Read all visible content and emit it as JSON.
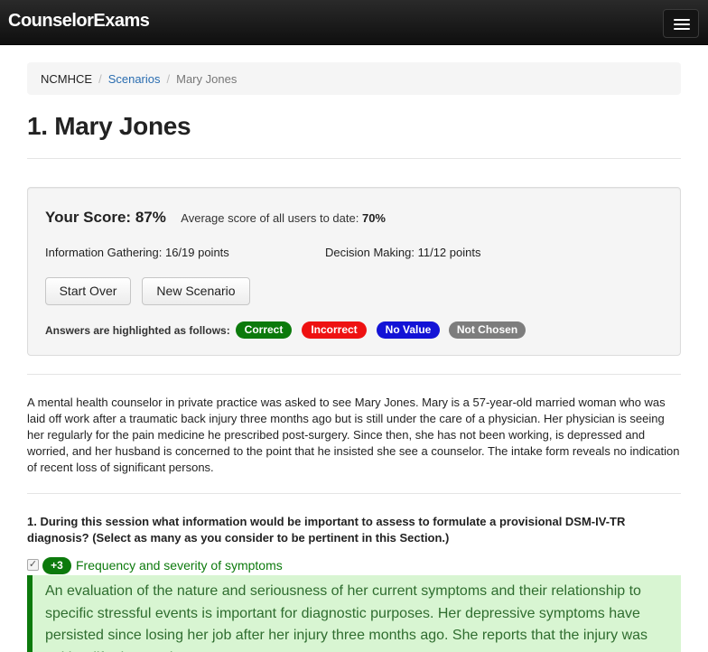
{
  "navbar": {
    "brand": "CounselorExams"
  },
  "breadcrumb": {
    "home": "NCMHCE",
    "separator": "/",
    "scenarios_link": "Scenarios",
    "current": "Mary Jones"
  },
  "page_title": "1. Mary Jones",
  "score": {
    "your_score_label": "Your Score: 87%",
    "average_prefix": "Average score of all users to date:",
    "average_value": "70%",
    "information_gathering": "Information Gathering: 16/19 points",
    "decision_making": "Decision Making: 11/12 points",
    "start_over_label": "Start Over",
    "new_scenario_label": "New Scenario",
    "legend_label": "Answers are highlighted as follows:",
    "legend": {
      "correct": "Correct",
      "incorrect": "Incorrect",
      "no_value": "No Value",
      "not_chosen": "Not Chosen"
    }
  },
  "colors": {
    "correct": "#0c7a0c",
    "incorrect": "#ee1111",
    "no_value": "#1313d6",
    "not_chosen": "#7d7d7d",
    "link": "#2a6db0",
    "explanation_bg": "#d8f5d2"
  },
  "scenario_text": "A mental health counselor in private practice was asked to see Mary Jones. Mary is a 57-year-old married woman who was laid off work after a traumatic back injury three months ago but is still under the care of a physician. Her physician is seeing her regularly for the pain medicine he prescribed post-surgery. Since then, she has not been working, is depressed and worried, and her husband is concerned to the point that he insisted she see a counselor. The intake form reveals no indication of recent loss of significant persons.",
  "question": {
    "text": "1. During this session what information would be important to assess to formulate a provisional DSM-IV-TR diagnosis? (Select as many as you consider to be pertinent in this Section.)",
    "answers": [
      {
        "checked": true,
        "checkbox_glyph": "✓",
        "points": "+3",
        "text": "Frequency and severity of symptoms",
        "explanation": "An evaluation of the nature and seriousness of her current symptoms and their relationship to specific stressful events is important for diagnostic purposes. Her depressive symptoms have persisted since losing her job after her injury three months ago. She reports that the injury was neither life-threatening"
      }
    ]
  }
}
